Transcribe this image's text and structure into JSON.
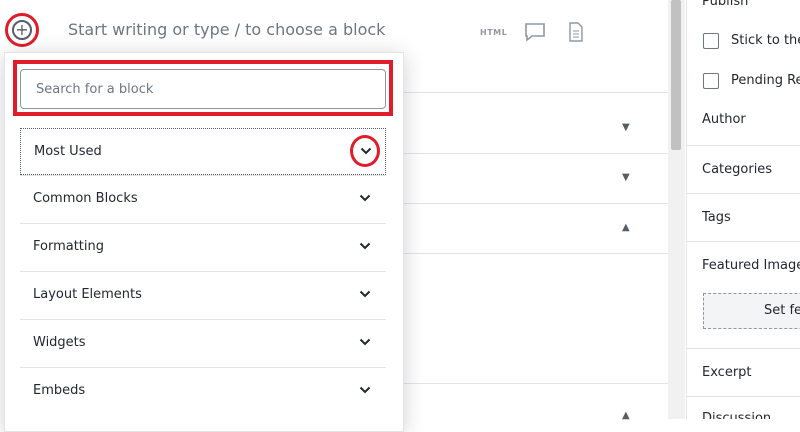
{
  "editor": {
    "placeholder": "Start writing or type / to choose a block",
    "add_block_icon": "plus-circle-icon",
    "toolbar": {
      "html_label": "HTML",
      "comment_icon": "comment-icon",
      "document_icon": "document-icon"
    }
  },
  "inserter": {
    "search_placeholder": "Search for a block",
    "categories": [
      {
        "label": "Most Used",
        "icon": "chevron-down-icon"
      },
      {
        "label": "Common Blocks",
        "icon": "chevron-down-icon"
      },
      {
        "label": "Formatting",
        "icon": "chevron-down-icon"
      },
      {
        "label": "Layout Elements",
        "icon": "chevron-down-icon"
      },
      {
        "label": "Widgets",
        "icon": "chevron-down-icon"
      },
      {
        "label": "Embeds",
        "icon": "chevron-down-icon"
      }
    ]
  },
  "sidebar": {
    "publish": "Publish",
    "sticky": "Stick to the Front Page",
    "pending": "Pending Review",
    "author": "Author",
    "categories": "Categories",
    "tags": "Tags",
    "featured_image": "Featured Image",
    "set_featured": "Set featured image",
    "excerpt": "Excerpt",
    "discussion": "Discussion"
  },
  "colors": {
    "highlight": "#e01c2b",
    "text": "#23282d",
    "muted": "#6c7781"
  }
}
